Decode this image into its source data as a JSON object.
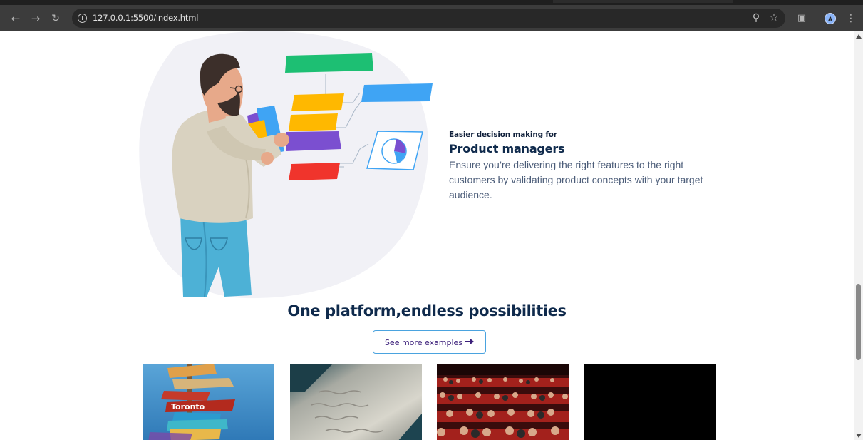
{
  "browser": {
    "url": "127.0.0.1:5500/index.html",
    "avatar_initial": "A",
    "icons": [
      "back-icon",
      "forward-icon",
      "reload-icon",
      "site-info-icon",
      "zoom-icon",
      "bookmark-star-icon",
      "extensions-icon",
      "menu-icon"
    ]
  },
  "feature": {
    "eyebrow": "Easier decision making for",
    "title": "Product managers",
    "description": "Ensure you’re delivering the right features to the right customers by validating product concepts with your target audience."
  },
  "section": {
    "heading": "One platform,endless possibilities",
    "cta_label": "See more examples"
  },
  "cards": [
    {
      "image": "travel-signpost-photo",
      "caption": ""
    },
    {
      "image": "handwritten-notes-photo",
      "caption": ""
    },
    {
      "image": "theater-audience-photo",
      "caption": ""
    },
    {
      "image": "black-placeholder",
      "caption": ""
    }
  ],
  "colors": {
    "heading": "#0f2a4c",
    "body_text": "#4c5d79",
    "cta_border": "#4aa3df",
    "cta_text": "#3b1f7a",
    "illustration_green": "#1dbf73",
    "illustration_blue": "#3fa4f4",
    "illustration_yellow": "#ffb800",
    "illustration_purple": "#7b4fd0",
    "illustration_red": "#f0342c"
  }
}
